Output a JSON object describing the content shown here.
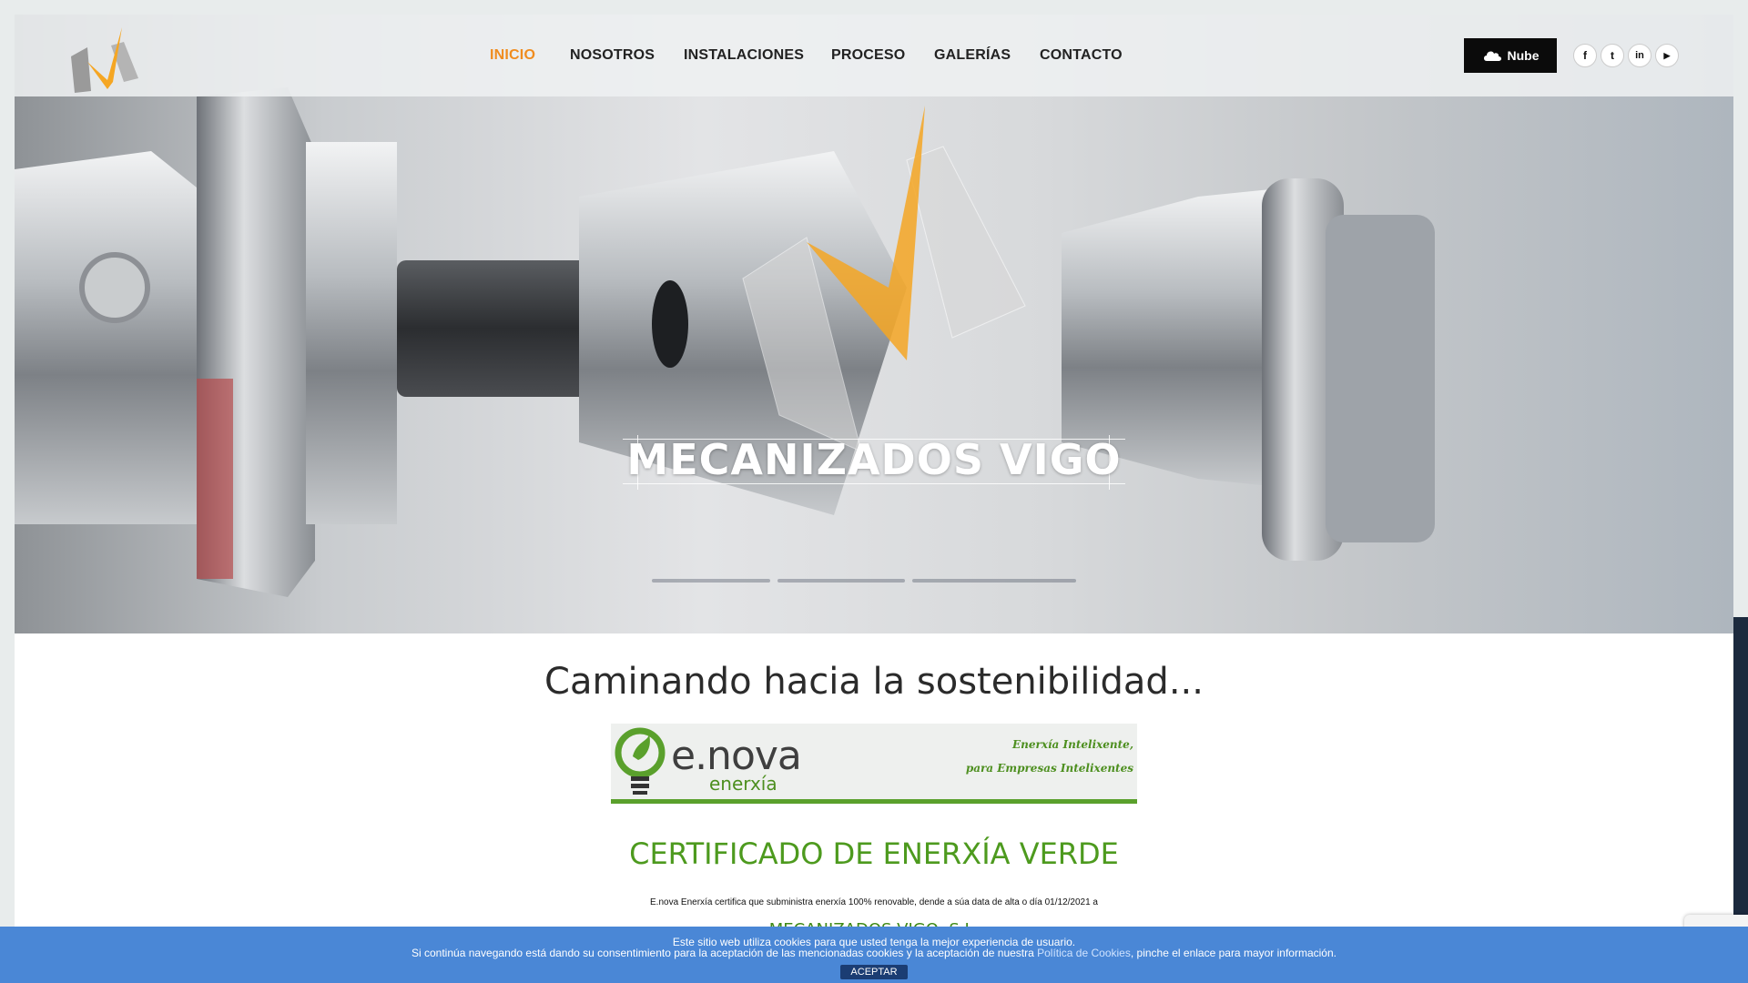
{
  "header": {
    "nav": [
      {
        "label": "INICIO",
        "active": true
      },
      {
        "label": "NOSOTROS",
        "active": false
      },
      {
        "label": "INSTALACIONES",
        "active": false
      },
      {
        "label": "PROCESO",
        "active": false
      },
      {
        "label": "GALERÍAS",
        "active": false
      },
      {
        "label": "CONTACTO",
        "active": false
      }
    ],
    "nube_label": "Nube",
    "social": [
      {
        "icon": "facebook-icon",
        "glyph": "f"
      },
      {
        "icon": "twitter-icon",
        "glyph": "t"
      },
      {
        "icon": "linkedin-icon",
        "glyph": "in"
      },
      {
        "icon": "youtube-icon",
        "glyph": "▶"
      }
    ]
  },
  "hero": {
    "title": "MECANIZADOS VIGO"
  },
  "main": {
    "section_title": "Caminando hacia la sostenibilidad...",
    "certificate": {
      "brand": "e.nova",
      "brand_sub": "enerxía",
      "tagline_1": "Enerxía Intelixente,",
      "tagline_2": "para Empresas Intelixentes",
      "heading": "CERTIFICADO DE ENERXÍA VERDE",
      "text": "E.nova Enerxía certifica que subministra enerxía 100% renovable, dende a súa data de alta o día 01/12/2021 a",
      "company": "MECANIZADOS VIGO, S.L."
    }
  },
  "cookie_bar": {
    "line1": "Este sitio web utiliza cookies para que usted tenga la mejor experiencia de usuario.",
    "line2_before": "Si continúa navegando está dando su consentimiento para la aceptación de las mencionadas cookies y la aceptación de nuestra ",
    "line2_link": "Política de Cookies",
    "line2_after": ", pinche el enlace para mayor información.",
    "accept": "ACEPTAR"
  },
  "colors": {
    "accent": "#f08c1e",
    "cookie_bg": "#4a87d6",
    "cert_green": "#4d9a1e"
  }
}
